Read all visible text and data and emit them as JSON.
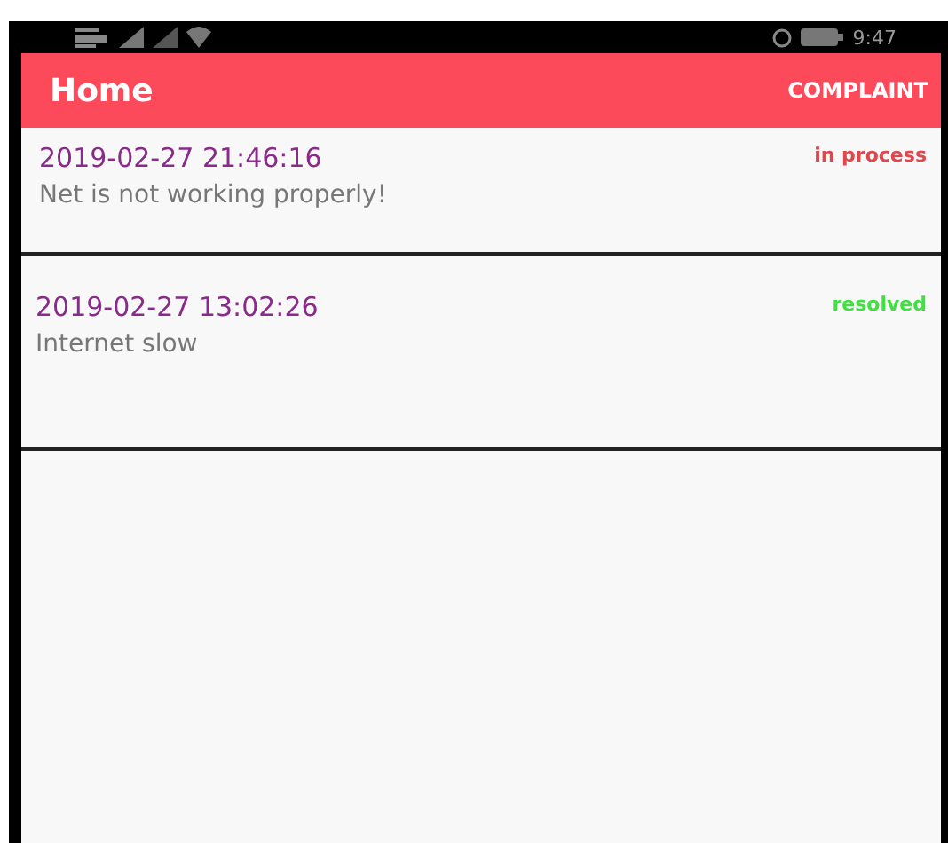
{
  "status_bar": {
    "time": "9:47"
  },
  "app_bar": {
    "title": "Home",
    "action": "COMPLAINT"
  },
  "complaints": [
    {
      "datetime": "2019-02-27 21:46:16",
      "text": "Net is not working properly!",
      "status": "in process",
      "color": "#e0474c"
    },
    {
      "datetime": "2019-02-27 13:02:26",
      "text": "Internet slow",
      "status": "resolved",
      "color": "#3fe03f"
    }
  ]
}
